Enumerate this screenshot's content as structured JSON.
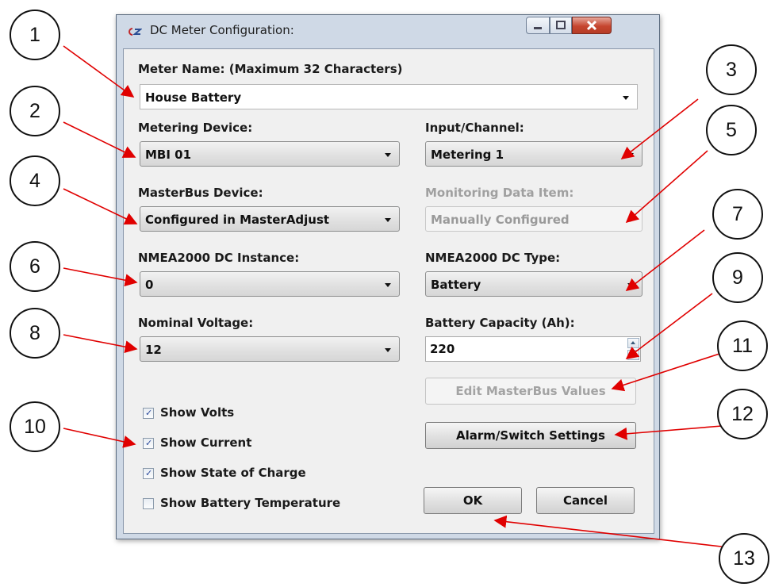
{
  "window": {
    "title": "DC Meter Configuration:",
    "controls": {
      "minimize": "minimize",
      "maximize": "maximize",
      "close": "close"
    }
  },
  "form": {
    "meter_name_label": "Meter Name: (Maximum 32 Characters)",
    "meter_name_value": "House Battery",
    "metering_device_label": "Metering Device:",
    "metering_device_value": "MBI 01",
    "input_channel_label": "Input/Channel:",
    "input_channel_value": "Metering 1",
    "masterbus_device_label": "MasterBus Device:",
    "masterbus_device_value": "Configured in MasterAdjust",
    "monitoring_item_label": "Monitoring Data Item:",
    "monitoring_item_value": "Manually Configured",
    "nmea_instance_label": "NMEA2000 DC Instance:",
    "nmea_instance_value": "0",
    "nmea_type_label": "NMEA2000 DC Type:",
    "nmea_type_value": "Battery",
    "nominal_voltage_label": "Nominal Voltage:",
    "nominal_voltage_value": "12",
    "battery_capacity_label": "Battery Capacity (Ah):",
    "battery_capacity_value": "220"
  },
  "buttons": {
    "edit_masterbus": "Edit MasterBus Values",
    "alarm_switch": "Alarm/Switch Settings",
    "ok": "OK",
    "cancel": "Cancel"
  },
  "checkboxes": [
    {
      "label": "Show Volts",
      "checked": true
    },
    {
      "label": "Show Current",
      "checked": true
    },
    {
      "label": "Show State of Charge",
      "checked": true
    },
    {
      "label": "Show Battery Temperature",
      "checked": false
    }
  ],
  "callouts": [
    "1",
    "2",
    "3",
    "4",
    "5",
    "6",
    "7",
    "8",
    "9",
    "10",
    "11",
    "12",
    "13"
  ],
  "colors": {
    "arrow": "#e00000",
    "callout_border": "#111111"
  }
}
